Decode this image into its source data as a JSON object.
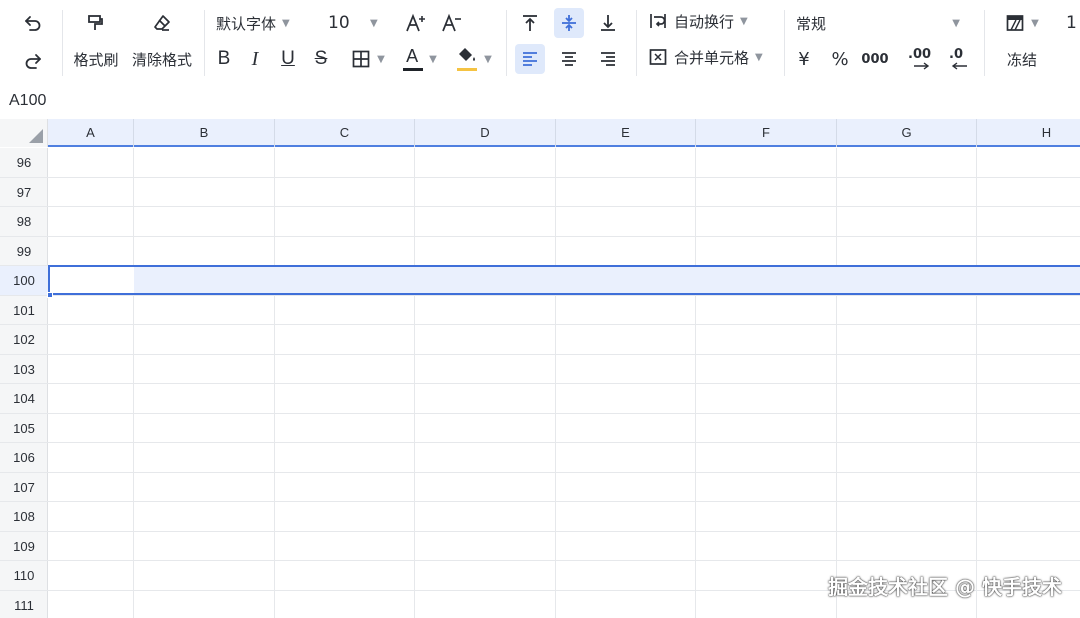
{
  "toolbar": {
    "format_painter": "格式刷",
    "clear_format": "清除格式",
    "font_family": "默认字体",
    "font_size": "10",
    "wrap_text": "自动换行",
    "merge_cells": "合并单元格",
    "number_format": "常规",
    "currency_symbol": "¥",
    "percent_symbol": "%",
    "thousands_symbol": "000",
    "freeze": "冻结",
    "bold": "B",
    "italic": "I",
    "underline": "U",
    "strikethrough": "S",
    "font_color_letter": "A",
    "font_color": "#1f2329",
    "fill_color": "#f5c342",
    "increase_decimal": ".00",
    "decrease_decimal": ".0",
    "cut_off_label": "1"
  },
  "name_box": {
    "value": "A100"
  },
  "columns": [
    "A",
    "B",
    "C",
    "D",
    "E",
    "F",
    "G",
    "H"
  ],
  "rows": [
    "96",
    "97",
    "98",
    "99",
    "100",
    "101",
    "102",
    "103",
    "104",
    "105",
    "106",
    "107",
    "108",
    "109",
    "110",
    "111"
  ],
  "selected_row": "100",
  "selection_color": "#3f6fd9",
  "watermark": "掘金技术社区 @ 快手技术"
}
